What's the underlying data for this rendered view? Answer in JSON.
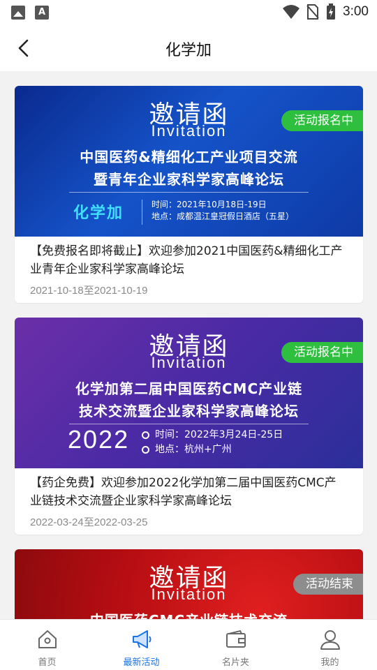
{
  "status_bar": {
    "time": "3:00"
  },
  "header": {
    "title": "化学加"
  },
  "events": [
    {
      "banner_style": "blue",
      "invitation": "邀请函",
      "invitation_en": "Invitation",
      "banner_line1": "中国医药&精细化工产业项目交流",
      "banner_line2": "暨青年企业家科学家高峰论坛",
      "brand": "化学加",
      "time_text": "时间：2021年10月18日-19日",
      "place_text": "地点：成都温江皇冠假日酒店（五星）",
      "status": "活动报名中",
      "status_type": "active",
      "title": "【免费报名即将截止】欢迎参加2021中国医药&精细化工产业青年企业家科学家高峰论坛",
      "date_range": "2021-10-18至2021-10-19"
    },
    {
      "banner_style": "purple",
      "invitation": "邀请函",
      "invitation_en": "Invitation",
      "banner_line1": "化学加第二届中国医药CMC产业链",
      "banner_line2": "技术交流暨企业家科学家高峰论坛",
      "year": "2022",
      "time_text": "时间：2022年3月24日-25日",
      "place_text": "地点：杭州+广州",
      "status": "活动报名中",
      "status_type": "active",
      "title": "【药企免费】欢迎参加2022化学加第二届中国医药CMC产业链技术交流暨企业家科学家高峰论坛",
      "date_range": "2022-03-24至2022-03-25"
    },
    {
      "banner_style": "red",
      "invitation": "邀请函",
      "invitation_en": "Invitation",
      "banner_line1": "中国医药CMC产业链技术交流",
      "status": "活动结束",
      "status_type": "ended"
    }
  ],
  "bottom_nav": [
    {
      "label": "首页",
      "icon": "home-icon",
      "active": false
    },
    {
      "label": "最新活动",
      "icon": "megaphone-icon",
      "active": true
    },
    {
      "label": "名片夹",
      "icon": "wallet-icon",
      "active": false
    },
    {
      "label": "我的",
      "icon": "user-icon",
      "active": false
    }
  ],
  "colors": {
    "accent": "#1a73e8",
    "badge_active": "#2fbf3f",
    "badge_ended": "#8d8d8d"
  }
}
